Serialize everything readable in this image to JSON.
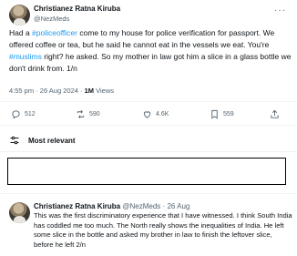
{
  "tweet": {
    "author_name": "Christianez Ratna Kiruba",
    "author_handle": "@NezMeds",
    "text_1": "Had a ",
    "hashtag_1": "#policeofficer",
    "text_2": " come to my house for police verification for passport. We offered coffee or tea, but he said he cannot eat in the vessels we eat. You're ",
    "hashtag_2": "#muslims",
    "text_3": " right? he asked. So my mother in law got him a slice in a glass bottle we don't drink from. 1/n",
    "time": "4:55 pm",
    "date": "26 Aug 2024",
    "views_count": "1M",
    "views_label": "Views",
    "more": "···",
    "stats": {
      "replies": "512",
      "reposts": "590",
      "likes": "4.6K",
      "bookmarks": "559"
    }
  },
  "sort": {
    "label": "Most relevant"
  },
  "reply": {
    "author_name": "Christianez Ratna Kiruba",
    "author_handle": "@NezMeds",
    "date": "26 Aug",
    "text": "This was the first discriminatory experience that I have witnessed. I think South India has coddled me too much. The North really shows the inequalities of India. He left some slice in the bottle and asked my brother in law to finish the leftover slice, before he left 2/n"
  },
  "colors": {
    "accent": "#1d9bf0",
    "secondary_text": "#536471",
    "primary_text": "#0f1419"
  }
}
